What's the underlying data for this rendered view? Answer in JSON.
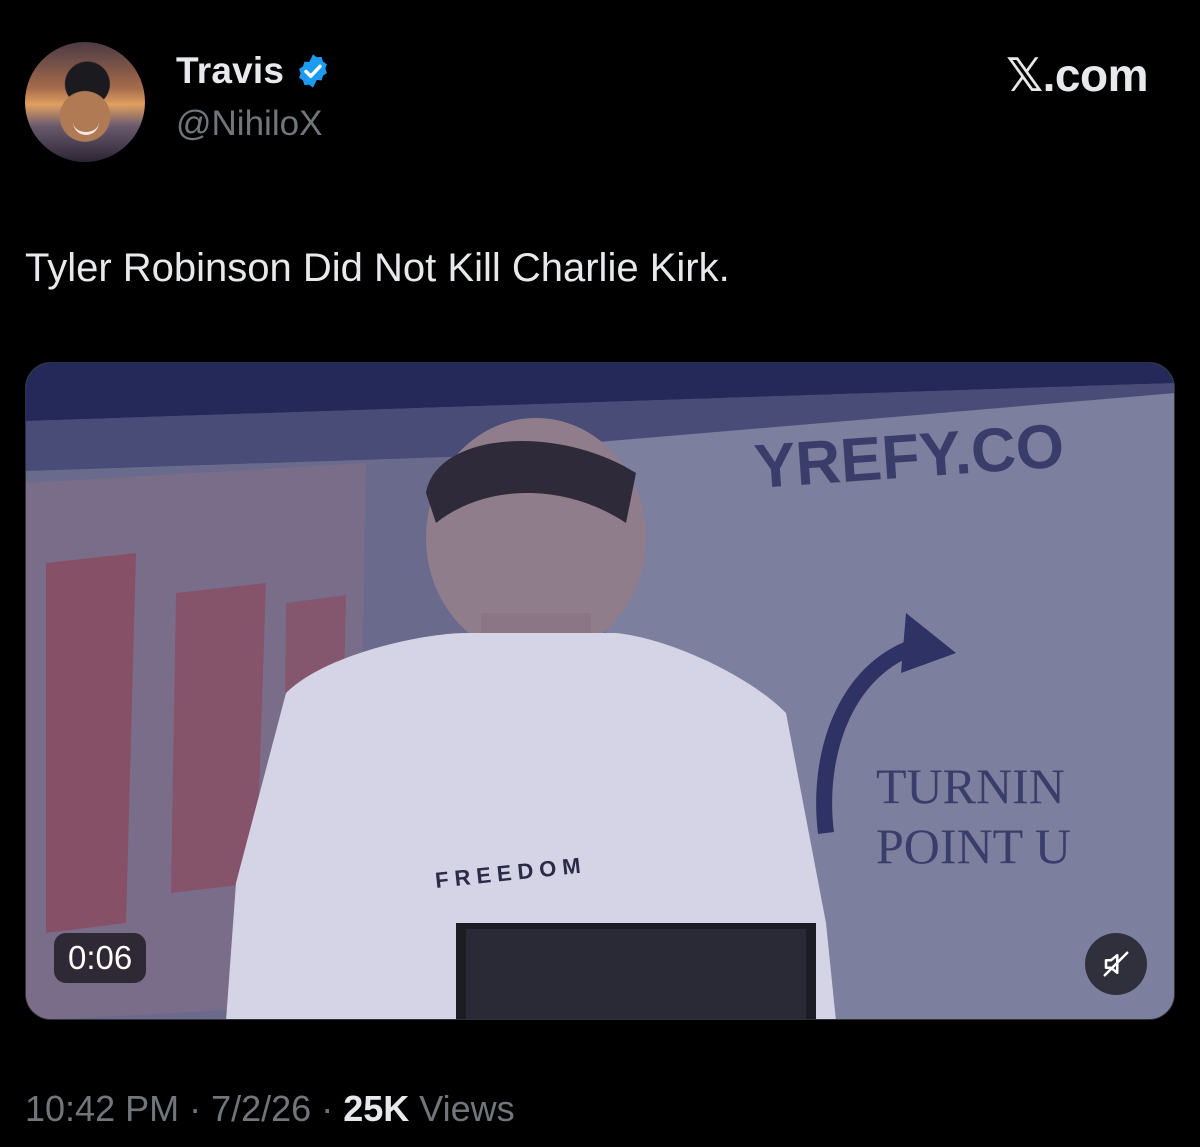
{
  "author": {
    "display_name": "Travis",
    "handle": "@NihiloX",
    "verified_icon": "verified-badge-icon",
    "verified_color": "#1d9bf0"
  },
  "brand": "𝕏.com",
  "tweet": {
    "text": "Tyler Robinson Did Not Kill Charlie Kirk."
  },
  "media": {
    "timestamp": "0:06",
    "mute_icon": "speaker-muted-icon",
    "scene_text": {
      "banner": "YREFY.CO",
      "logo_line1": "TURNIN",
      "logo_line2": "POINT U",
      "shirt": "FREEDOM"
    }
  },
  "meta": {
    "time": "10:42 PM",
    "separator": "·",
    "date": "7/2/26",
    "views_count": "25K",
    "views_label": "Views"
  }
}
